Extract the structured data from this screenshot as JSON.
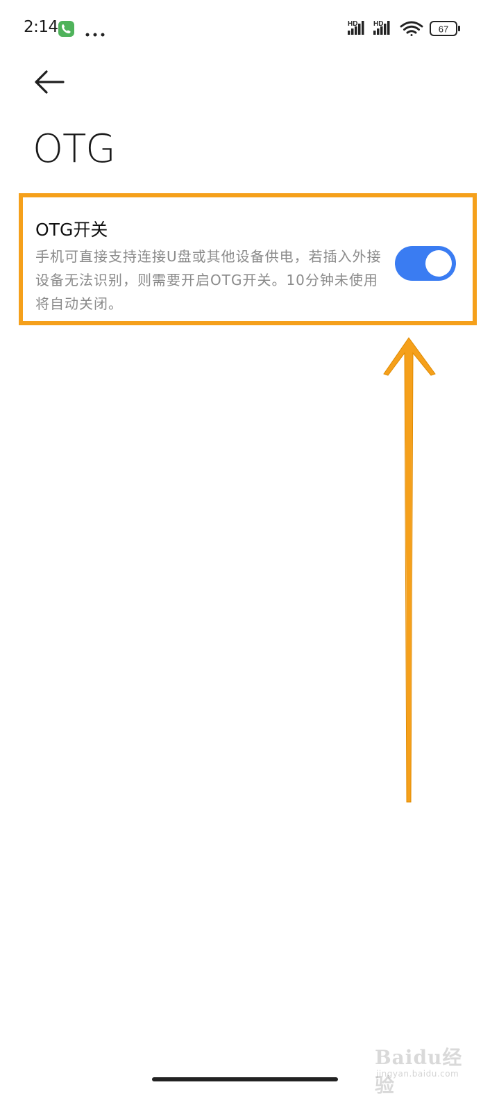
{
  "status_bar": {
    "time": "2:14",
    "call_icon": "phone-icon",
    "more_icon": "more-dots-icon",
    "network_1": "HD",
    "network_2": "HD",
    "wifi_icon": "wifi-icon",
    "battery_level": "67"
  },
  "header": {
    "back_icon": "back-arrow-icon",
    "title": "OTG"
  },
  "otg_setting": {
    "title": "OTG开关",
    "description": "手机可直接支持连接U盘或其他设备供电，若插入外接设备无法识别，则需要开启OTG开关。10分钟未使用将自动关闭。",
    "enabled": true
  },
  "watermark": {
    "text": "Baidu经验",
    "sub": "jingyan.baidu.com"
  },
  "colors": {
    "highlight_border": "#f5a01b",
    "toggle_on": "#3a7cf2",
    "call_badge": "#4fb35b",
    "arrow": "#f5a01b"
  }
}
